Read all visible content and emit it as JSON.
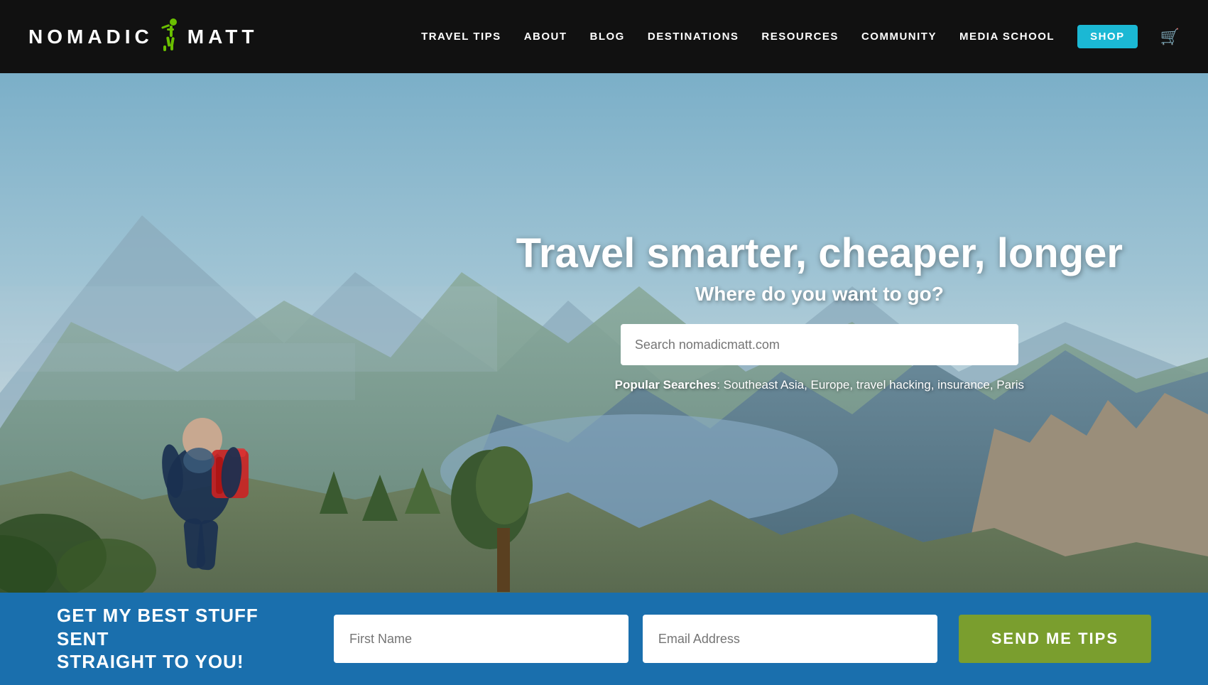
{
  "header": {
    "logo": {
      "nomadic": "NoMADIC",
      "matt": "MATT"
    },
    "nav": {
      "items": [
        {
          "label": "TRAVEL TIPS",
          "id": "travel-tips"
        },
        {
          "label": "ABOUT",
          "id": "about"
        },
        {
          "label": "BLOG",
          "id": "blog"
        },
        {
          "label": "DESTINATIONS",
          "id": "destinations"
        },
        {
          "label": "RESOURCES",
          "id": "resources"
        },
        {
          "label": "COMMUNITY",
          "id": "community"
        },
        {
          "label": "MEDIA SCHOOL",
          "id": "media-school"
        },
        {
          "label": "SHOP",
          "id": "shop"
        }
      ]
    }
  },
  "hero": {
    "headline": "Travel smarter, cheaper, longer",
    "subheadline": "Where do you want to go?",
    "search_placeholder": "Search nomadicmatt.com",
    "popular_searches_label": "Popular Searches",
    "popular_searches_text": ": Southeast Asia, Europe, travel hacking, insurance, Paris"
  },
  "bottom_bar": {
    "cta_text_line1": "GET MY BEST STUFF SENT",
    "cta_text_line2": "STRAIGHT TO YOU!",
    "first_name_placeholder": "First Name",
    "email_placeholder": "Email Address",
    "button_label": "SEND ME TIPS"
  }
}
